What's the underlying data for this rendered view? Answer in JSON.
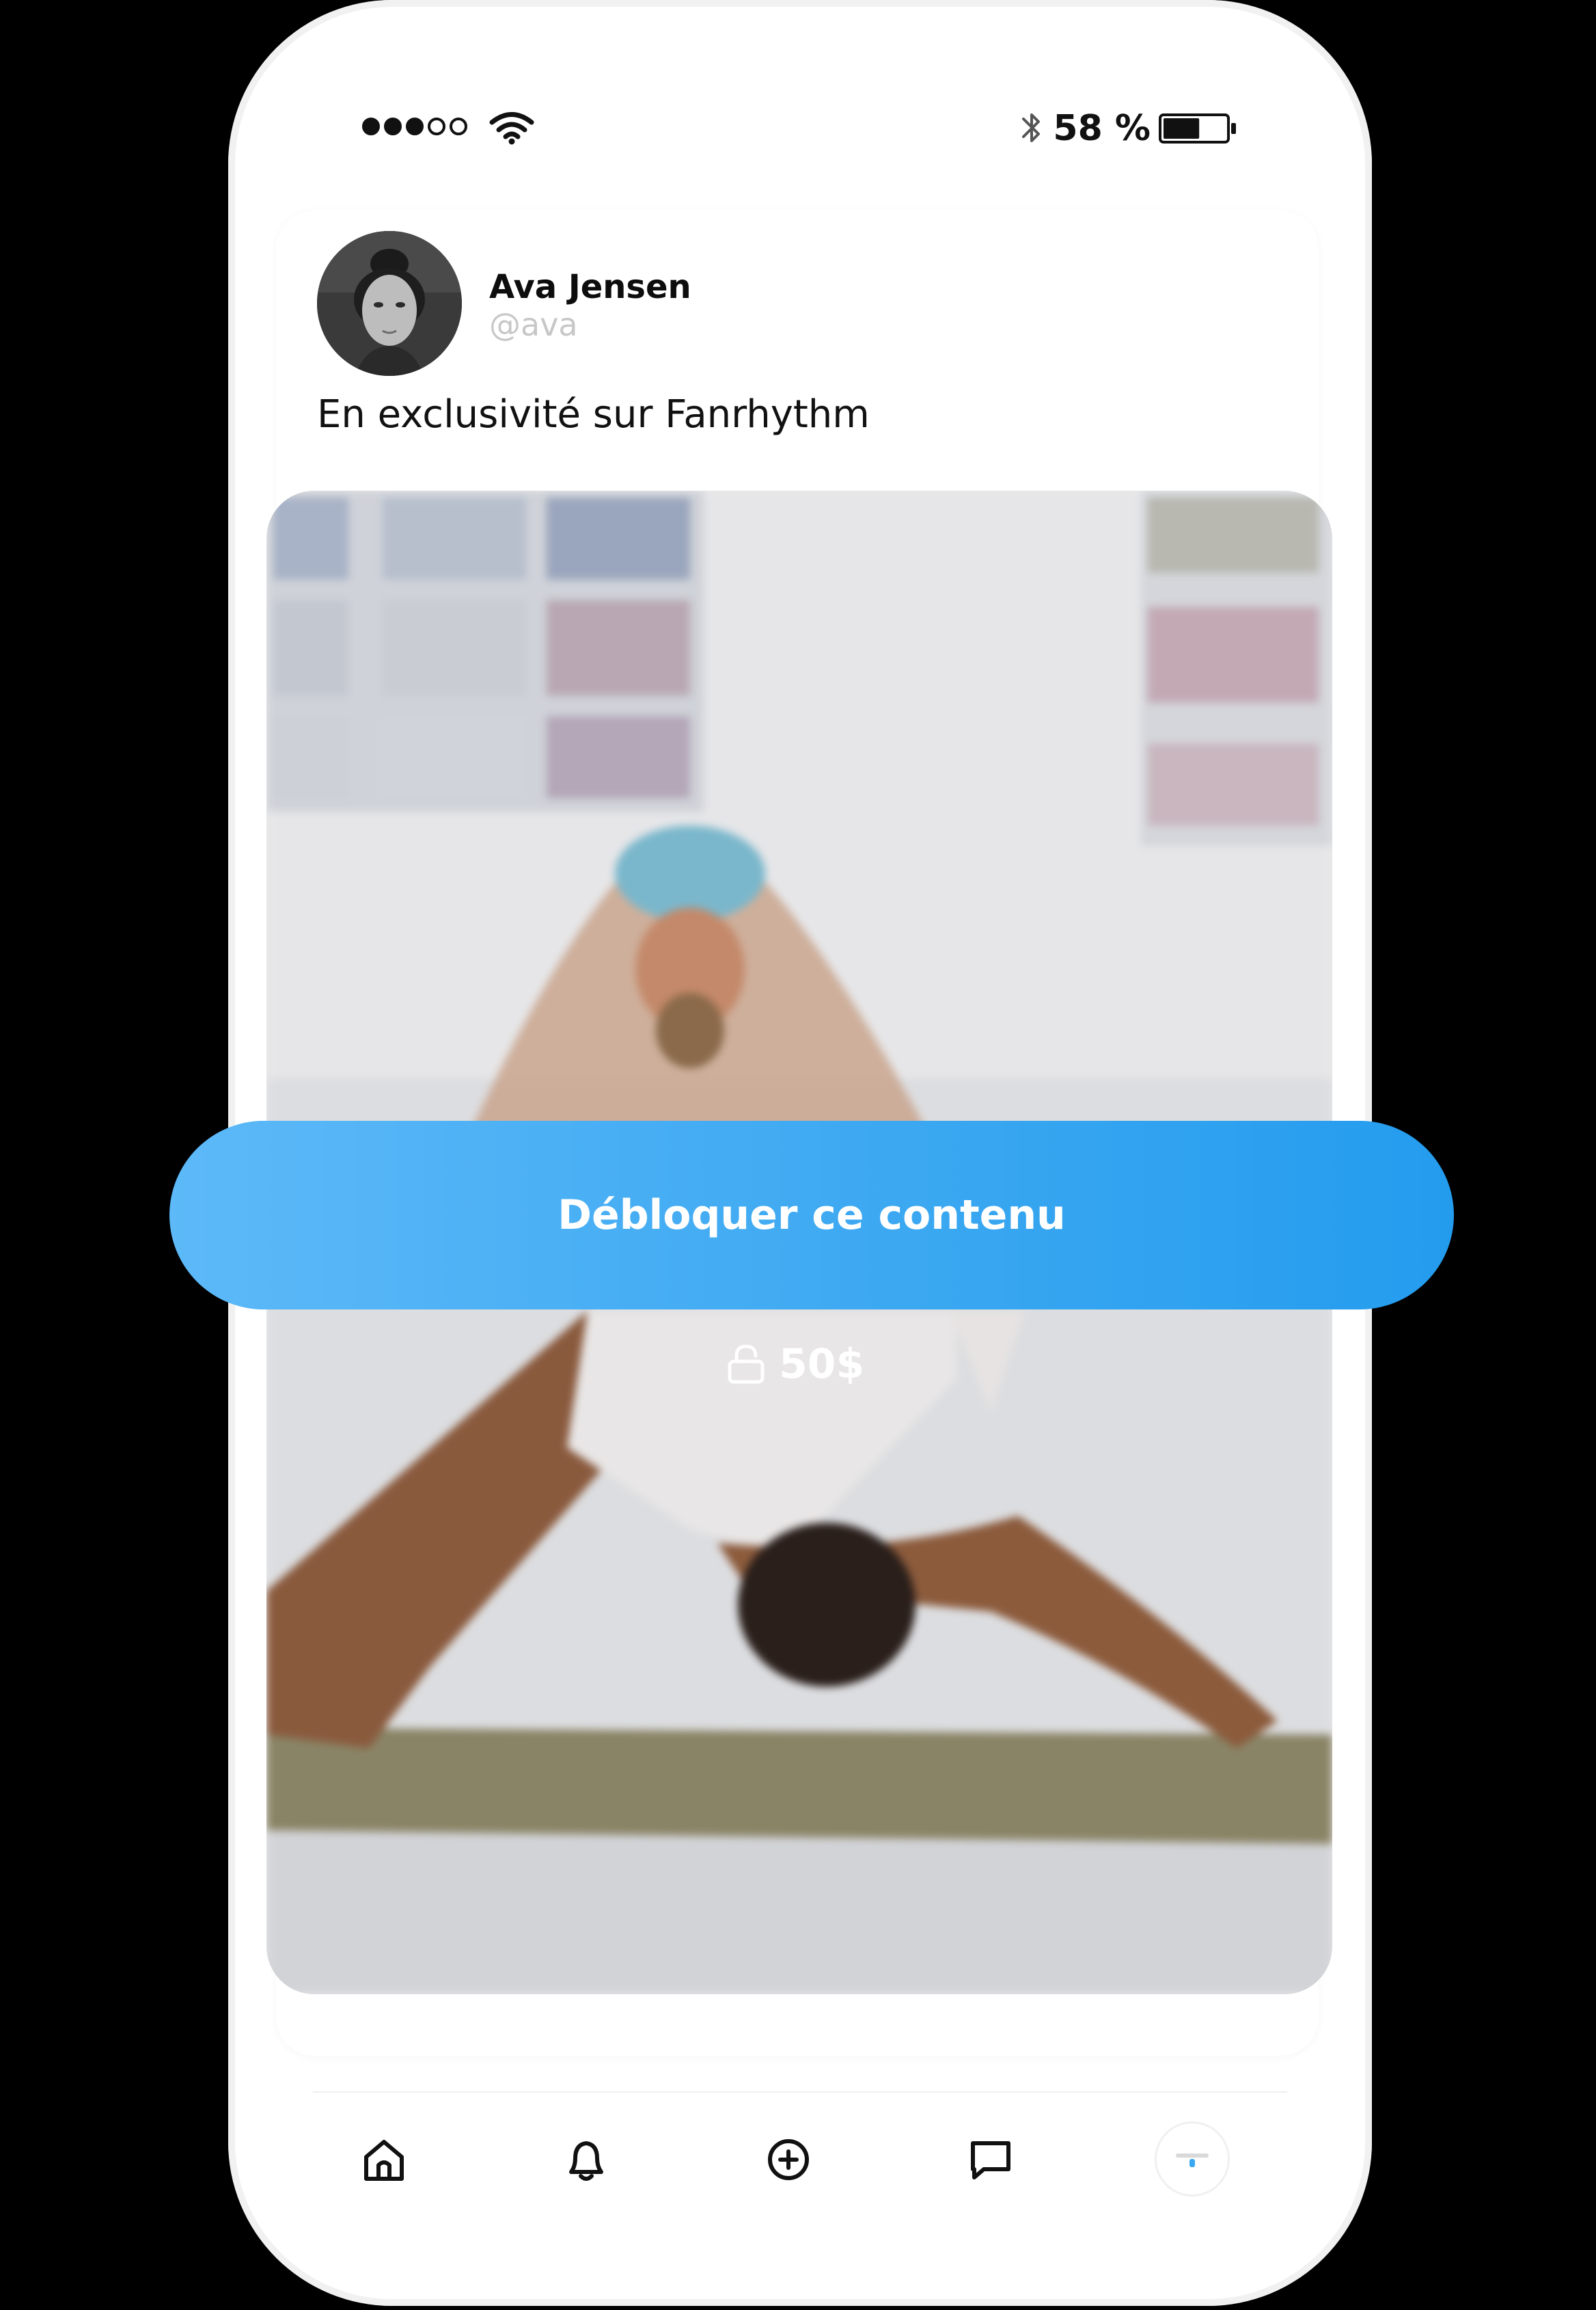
{
  "status_bar": {
    "signal_bars_filled": 3,
    "signal_bars_total": 5,
    "battery_text": "58 %",
    "battery_level_percent": 58,
    "icons": [
      "wifi-icon",
      "bluetooth-icon",
      "battery-icon"
    ]
  },
  "post": {
    "author_name": "Ava Jensen",
    "author_handle": "@ava",
    "text": "En exclusivité sur Fanrhythm",
    "locked": true
  },
  "unlock": {
    "button_label": "Débloquer ce contenu",
    "price": "50$",
    "icon": "lock-icon"
  },
  "bottom_nav": {
    "items": [
      {
        "icon": "home-icon"
      },
      {
        "icon": "bell-icon"
      },
      {
        "icon": "add-circle-icon"
      },
      {
        "icon": "chat-icon"
      },
      {
        "icon": "profile-avatar"
      }
    ]
  },
  "colors": {
    "accent_start": "#5db9f8",
    "accent_end": "#249cee",
    "text_primary": "#0d0d0d",
    "text_muted": "#c7c7c7"
  }
}
